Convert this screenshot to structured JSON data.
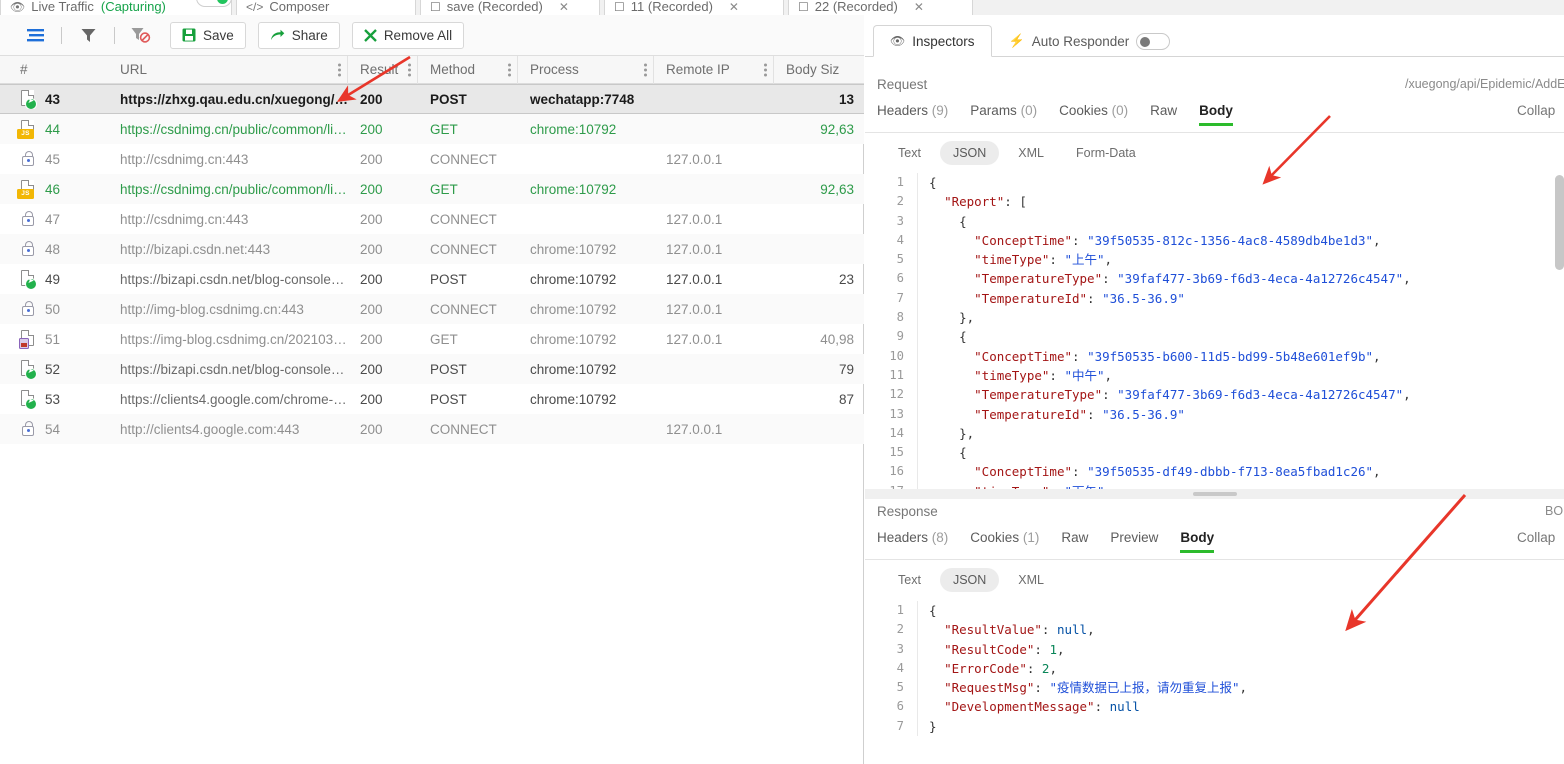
{
  "tabs": [
    {
      "label": "Live Traffic",
      "sub": "(Capturing)",
      "icon": "eye-icon",
      "closable": false,
      "active": true
    },
    {
      "label": "Composer",
      "sub": "",
      "icon": "code-icon",
      "closable": false,
      "active": false
    },
    {
      "label": "save (Recorded)",
      "sub": "",
      "icon": "file-icon",
      "closable": true,
      "active": false
    },
    {
      "label": "11 (Recorded)",
      "sub": "",
      "icon": "file-icon",
      "closable": true,
      "active": false
    },
    {
      "label": "22 (Recorded)",
      "sub": "",
      "icon": "file-icon",
      "closable": true,
      "active": false
    }
  ],
  "toolbar": {
    "list_icon": "list-icon",
    "filter_icon": "filter-icon",
    "clear_filter_icon": "filter-off-icon",
    "save_label": "Save",
    "share_label": "Share",
    "remove_all_label": "Remove All"
  },
  "table": {
    "columns": [
      "#",
      "URL",
      "Result",
      "Method",
      "Process",
      "Remote IP",
      "Body Siz"
    ],
    "rows": [
      {
        "icon": "post-doc-icon",
        "id": "43",
        "url": "https://zhxg.qau.edu.cn/xuegong/api/...",
        "result": "200",
        "method": "POST",
        "process": "wechatapp:7748",
        "remote_ip": "",
        "body_size": "13",
        "style": "selected"
      },
      {
        "icon": "js-doc-icon",
        "id": "44",
        "url": "https://csdnimg.cn/public/common/lib...",
        "result": "200",
        "method": "GET",
        "process": "chrome:10792",
        "remote_ip": "",
        "body_size": "92,63",
        "style": "green"
      },
      {
        "icon": "lock-icon",
        "id": "45",
        "url": "http://csdnimg.cn:443",
        "result": "200",
        "method": "CONNECT",
        "process": "",
        "remote_ip": "127.0.0.1",
        "body_size": "",
        "style": "gray"
      },
      {
        "icon": "js-doc-icon",
        "id": "46",
        "url": "https://csdnimg.cn/public/common/lib...",
        "result": "200",
        "method": "GET",
        "process": "chrome:10792",
        "remote_ip": "",
        "body_size": "92,63",
        "style": "green"
      },
      {
        "icon": "lock-icon",
        "id": "47",
        "url": "http://csdnimg.cn:443",
        "result": "200",
        "method": "CONNECT",
        "process": "",
        "remote_ip": "127.0.0.1",
        "body_size": "",
        "style": "gray"
      },
      {
        "icon": "lock-icon",
        "id": "48",
        "url": "http://bizapi.csdn.net:443",
        "result": "200",
        "method": "CONNECT",
        "process": "chrome:10792",
        "remote_ip": "127.0.0.1",
        "body_size": "",
        "style": "gray"
      },
      {
        "icon": "post-doc-icon",
        "id": "49",
        "url": "https://bizapi.csdn.net/blog-console-a...",
        "result": "200",
        "method": "POST",
        "process": "chrome:10792",
        "remote_ip": "127.0.0.1",
        "body_size": "23",
        "style": "dark"
      },
      {
        "icon": "lock-icon",
        "id": "50",
        "url": "http://img-blog.csdnimg.cn:443",
        "result": "200",
        "method": "CONNECT",
        "process": "chrome:10792",
        "remote_ip": "127.0.0.1",
        "body_size": "",
        "style": "gray"
      },
      {
        "icon": "img-doc-icon",
        "id": "51",
        "url": "https://img-blog.csdnimg.cn/20210308...",
        "result": "200",
        "method": "GET",
        "process": "chrome:10792",
        "remote_ip": "127.0.0.1",
        "body_size": "40,98",
        "style": "gray"
      },
      {
        "icon": "post-doc-icon",
        "id": "52",
        "url": "https://bizapi.csdn.net/blog-console-a...",
        "result": "200",
        "method": "POST",
        "process": "chrome:10792",
        "remote_ip": "",
        "body_size": "79",
        "style": "dark"
      },
      {
        "icon": "post-doc-icon",
        "id": "53",
        "url": "https://clients4.google.com/chrome-sy...",
        "result": "200",
        "method": "POST",
        "process": "chrome:10792",
        "remote_ip": "",
        "body_size": "87",
        "style": "dark"
      },
      {
        "icon": "lock-icon",
        "id": "54",
        "url": "http://clients4.google.com:443",
        "result": "200",
        "method": "CONNECT",
        "process": "",
        "remote_ip": "127.0.0.1",
        "body_size": "",
        "style": "gray"
      }
    ]
  },
  "inspector": {
    "tabs": [
      {
        "label": "Inspectors",
        "icon": "eye-icon",
        "active": true,
        "toggle": false
      },
      {
        "label": "Auto Responder",
        "icon": "bolt-icon",
        "active": false,
        "toggle": true
      }
    ],
    "request": {
      "title": "Request",
      "url_path": "/xuegong/api/Epidemic/AddEpid",
      "collapse_label": "Collap",
      "subtabs": [
        {
          "label": "Headers",
          "count": "(9)",
          "active": false
        },
        {
          "label": "Params",
          "count": "(0)",
          "active": false
        },
        {
          "label": "Cookies",
          "count": "(0)",
          "active": false
        },
        {
          "label": "Raw",
          "count": "",
          "active": false
        },
        {
          "label": "Body",
          "count": "",
          "active": true
        }
      ],
      "formats": [
        {
          "label": "Text",
          "active": false
        },
        {
          "label": "JSON",
          "active": true
        },
        {
          "label": "XML",
          "active": false
        },
        {
          "label": "Form-Data",
          "active": false
        }
      ],
      "code_lines": [
        {
          "n": "1",
          "tokens": [
            {
              "t": "p",
              "v": "{"
            }
          ]
        },
        {
          "n": "2",
          "tokens": [
            {
              "t": "p",
              "v": "  "
            },
            {
              "t": "k",
              "v": "\"Report\""
            },
            {
              "t": "p",
              "v": ": ["
            }
          ]
        },
        {
          "n": "3",
          "tokens": [
            {
              "t": "p",
              "v": "    {"
            }
          ]
        },
        {
          "n": "4",
          "tokens": [
            {
              "t": "p",
              "v": "      "
            },
            {
              "t": "k",
              "v": "\"ConceptTime\""
            },
            {
              "t": "p",
              "v": ": "
            },
            {
              "t": "s",
              "v": "\"39f50535-812c-1356-4ac8-4589db4be1d3\""
            },
            {
              "t": "p",
              "v": ","
            }
          ]
        },
        {
          "n": "5",
          "tokens": [
            {
              "t": "p",
              "v": "      "
            },
            {
              "t": "k",
              "v": "\"timeType\""
            },
            {
              "t": "p",
              "v": ": "
            },
            {
              "t": "s",
              "v": "\"上午\""
            },
            {
              "t": "p",
              "v": ","
            }
          ]
        },
        {
          "n": "6",
          "tokens": [
            {
              "t": "p",
              "v": "      "
            },
            {
              "t": "k",
              "v": "\"TemperatureType\""
            },
            {
              "t": "p",
              "v": ": "
            },
            {
              "t": "s",
              "v": "\"39faf477-3b69-f6d3-4eca-4a12726c4547\""
            },
            {
              "t": "p",
              "v": ","
            }
          ]
        },
        {
          "n": "7",
          "tokens": [
            {
              "t": "p",
              "v": "      "
            },
            {
              "t": "k",
              "v": "\"TemperatureId\""
            },
            {
              "t": "p",
              "v": ": "
            },
            {
              "t": "s",
              "v": "\"36.5-36.9\""
            }
          ]
        },
        {
          "n": "8",
          "tokens": [
            {
              "t": "p",
              "v": "    },"
            }
          ]
        },
        {
          "n": "9",
          "tokens": [
            {
              "t": "p",
              "v": "    {"
            }
          ]
        },
        {
          "n": "10",
          "tokens": [
            {
              "t": "p",
              "v": "      "
            },
            {
              "t": "k",
              "v": "\"ConceptTime\""
            },
            {
              "t": "p",
              "v": ": "
            },
            {
              "t": "s",
              "v": "\"39f50535-b600-11d5-bd99-5b48e601ef9b\""
            },
            {
              "t": "p",
              "v": ","
            }
          ]
        },
        {
          "n": "11",
          "tokens": [
            {
              "t": "p",
              "v": "      "
            },
            {
              "t": "k",
              "v": "\"timeType\""
            },
            {
              "t": "p",
              "v": ": "
            },
            {
              "t": "s",
              "v": "\"中午\""
            },
            {
              "t": "p",
              "v": ","
            }
          ]
        },
        {
          "n": "12",
          "tokens": [
            {
              "t": "p",
              "v": "      "
            },
            {
              "t": "k",
              "v": "\"TemperatureType\""
            },
            {
              "t": "p",
              "v": ": "
            },
            {
              "t": "s",
              "v": "\"39faf477-3b69-f6d3-4eca-4a12726c4547\""
            },
            {
              "t": "p",
              "v": ","
            }
          ]
        },
        {
          "n": "13",
          "tokens": [
            {
              "t": "p",
              "v": "      "
            },
            {
              "t": "k",
              "v": "\"TemperatureId\""
            },
            {
              "t": "p",
              "v": ": "
            },
            {
              "t": "s",
              "v": "\"36.5-36.9\""
            }
          ]
        },
        {
          "n": "14",
          "tokens": [
            {
              "t": "p",
              "v": "    },"
            }
          ]
        },
        {
          "n": "15",
          "tokens": [
            {
              "t": "p",
              "v": "    {"
            }
          ]
        },
        {
          "n": "16",
          "tokens": [
            {
              "t": "p",
              "v": "      "
            },
            {
              "t": "k",
              "v": "\"ConceptTime\""
            },
            {
              "t": "p",
              "v": ": "
            },
            {
              "t": "s",
              "v": "\"39f50535-df49-dbbb-f713-8ea5fbad1c26\""
            },
            {
              "t": "p",
              "v": ","
            }
          ]
        },
        {
          "n": "17",
          "tokens": [
            {
              "t": "p",
              "v": "      "
            },
            {
              "t": "k",
              "v": "\"timeType\""
            },
            {
              "t": "p",
              "v": ": "
            },
            {
              "t": "s",
              "v": "\"下午\""
            },
            {
              "t": "p",
              "v": ","
            }
          ]
        }
      ]
    },
    "response": {
      "title": "Response",
      "corner_label": "BO",
      "collapse_label": "Collap",
      "subtabs": [
        {
          "label": "Headers",
          "count": "(8)",
          "active": false
        },
        {
          "label": "Cookies",
          "count": "(1)",
          "active": false
        },
        {
          "label": "Raw",
          "count": "",
          "active": false
        },
        {
          "label": "Preview",
          "count": "",
          "active": false
        },
        {
          "label": "Body",
          "count": "",
          "active": true
        }
      ],
      "formats": [
        {
          "label": "Text",
          "active": false
        },
        {
          "label": "JSON",
          "active": true
        },
        {
          "label": "XML",
          "active": false
        }
      ],
      "code_lines": [
        {
          "n": "1",
          "tokens": [
            {
              "t": "p",
              "v": "{"
            }
          ]
        },
        {
          "n": "2",
          "tokens": [
            {
              "t": "p",
              "v": "  "
            },
            {
              "t": "k",
              "v": "\"ResultValue\""
            },
            {
              "t": "p",
              "v": ": "
            },
            {
              "t": "nul",
              "v": "null"
            },
            {
              "t": "p",
              "v": ","
            }
          ]
        },
        {
          "n": "3",
          "tokens": [
            {
              "t": "p",
              "v": "  "
            },
            {
              "t": "k",
              "v": "\"ResultCode\""
            },
            {
              "t": "p",
              "v": ": "
            },
            {
              "t": "n",
              "v": "1"
            },
            {
              "t": "p",
              "v": ","
            }
          ]
        },
        {
          "n": "4",
          "tokens": [
            {
              "t": "p",
              "v": "  "
            },
            {
              "t": "k",
              "v": "\"ErrorCode\""
            },
            {
              "t": "p",
              "v": ": "
            },
            {
              "t": "n",
              "v": "2"
            },
            {
              "t": "p",
              "v": ","
            }
          ]
        },
        {
          "n": "5",
          "tokens": [
            {
              "t": "p",
              "v": "  "
            },
            {
              "t": "k",
              "v": "\"RequestMsg\""
            },
            {
              "t": "p",
              "v": ": "
            },
            {
              "t": "s",
              "v": "\"疫情数据已上报，请勿重复上报\""
            },
            {
              "t": "p",
              "v": ","
            }
          ]
        },
        {
          "n": "6",
          "tokens": [
            {
              "t": "p",
              "v": "  "
            },
            {
              "t": "k",
              "v": "\"DevelopmentMessage\""
            },
            {
              "t": "p",
              "v": ": "
            },
            {
              "t": "nul",
              "v": "null"
            }
          ]
        },
        {
          "n": "7",
          "tokens": [
            {
              "t": "p",
              "v": "}"
            }
          ]
        }
      ]
    }
  },
  "colors": {
    "accent_green": "#2cbb2c",
    "link_green": "#2e9b4a",
    "annotation_red": "#e8362a",
    "key_red": "#a31515",
    "string_blue": "#1f4fd8"
  }
}
